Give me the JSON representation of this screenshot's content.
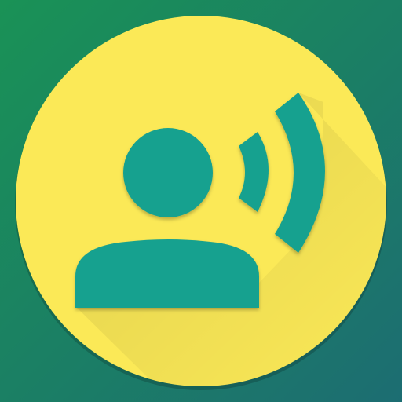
{
  "app_icon": {
    "name": "voice-access-app-icon",
    "icon_name": "person-speaking-icon",
    "colors": {
      "background_top_left": "#1a9256",
      "background_bottom_right": "#1c6d72",
      "badge": "#fbe957",
      "badge_shadow": "#e2cf45",
      "glyph": "#15a18f",
      "glyph_shadow": "#0f7f71"
    }
  }
}
